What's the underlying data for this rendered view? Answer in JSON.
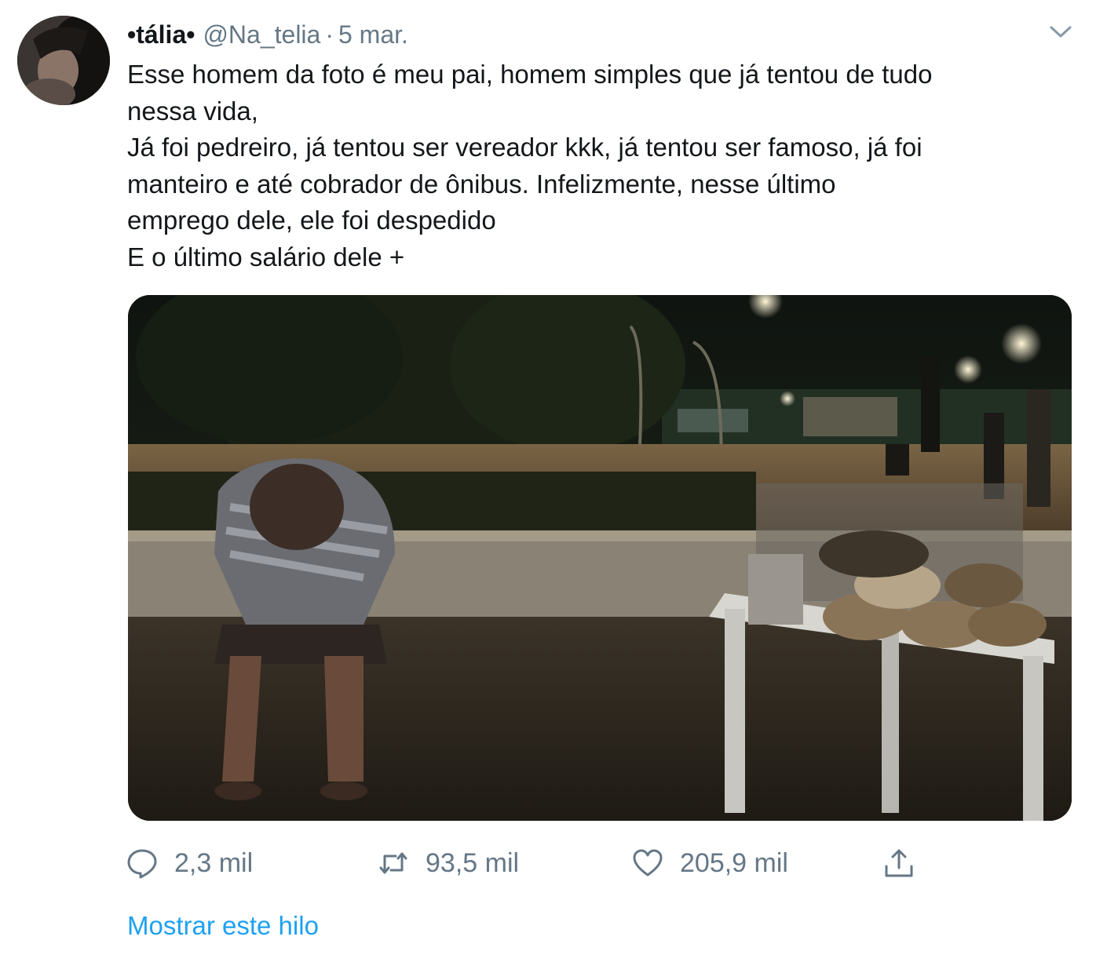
{
  "author": {
    "display_name": "•tália•",
    "handle": "@Na_telia",
    "separator": "·",
    "date": "5 mar."
  },
  "tweet": {
    "lines": [
      "Esse homem da foto é meu pai, homem simples que já tentou de tudo",
      "nessa vida,",
      "Já foi pedreiro, já tentou ser vereador kkk, já tentou ser famoso, já foi",
      "manteiro e até cobrador de ônibus. Infelizmente, nesse último",
      "emprego dele, ele foi despedido",
      "E o último salário dele +"
    ]
  },
  "actions": {
    "reply_count": "2,3 mil",
    "retweet_count": "93,5 mil",
    "like_count": "205,9 mil"
  },
  "thread_link": "Mostrar este hilo",
  "icons": {
    "caret": "chevron-down-icon",
    "reply": "speech-bubble-icon",
    "retweet": "retweet-arrows-icon",
    "like": "heart-icon",
    "share": "share-upload-icon"
  },
  "colors": {
    "text": "#14171a",
    "secondary": "#657786",
    "link": "#1da1f2"
  }
}
